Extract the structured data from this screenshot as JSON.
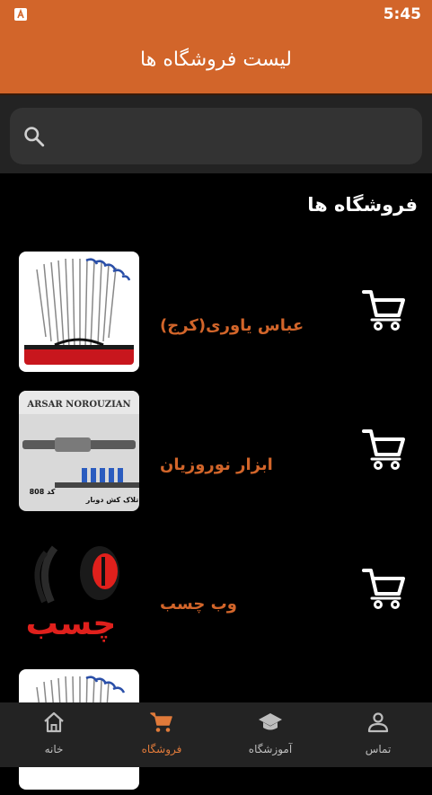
{
  "status": {
    "time": "5:45"
  },
  "appbar": {
    "title": "لیست فروشگاه ها"
  },
  "search": {
    "placeholder": ""
  },
  "section": {
    "title": "فروشگاه ها"
  },
  "stores": [
    {
      "name": "عباس یاوری(کرج)",
      "thumb_text": ""
    },
    {
      "name": "ابزار نوروزیان",
      "thumb_text": "ARSAR NOROUZIAN",
      "thumb_caption": "تلاک کش دوبار",
      "thumb_code": "کد 808"
    },
    {
      "name": "وب چسب",
      "thumb_text": "چسب"
    },
    {
      "name": "",
      "thumb_text": ""
    }
  ],
  "nav": {
    "home": "خانه",
    "stores": "فروشگاه",
    "training": "آموزشگاه",
    "contact": "تماس"
  },
  "colors": {
    "accent": "#d2652a",
    "navActive": "#e07a3a"
  }
}
